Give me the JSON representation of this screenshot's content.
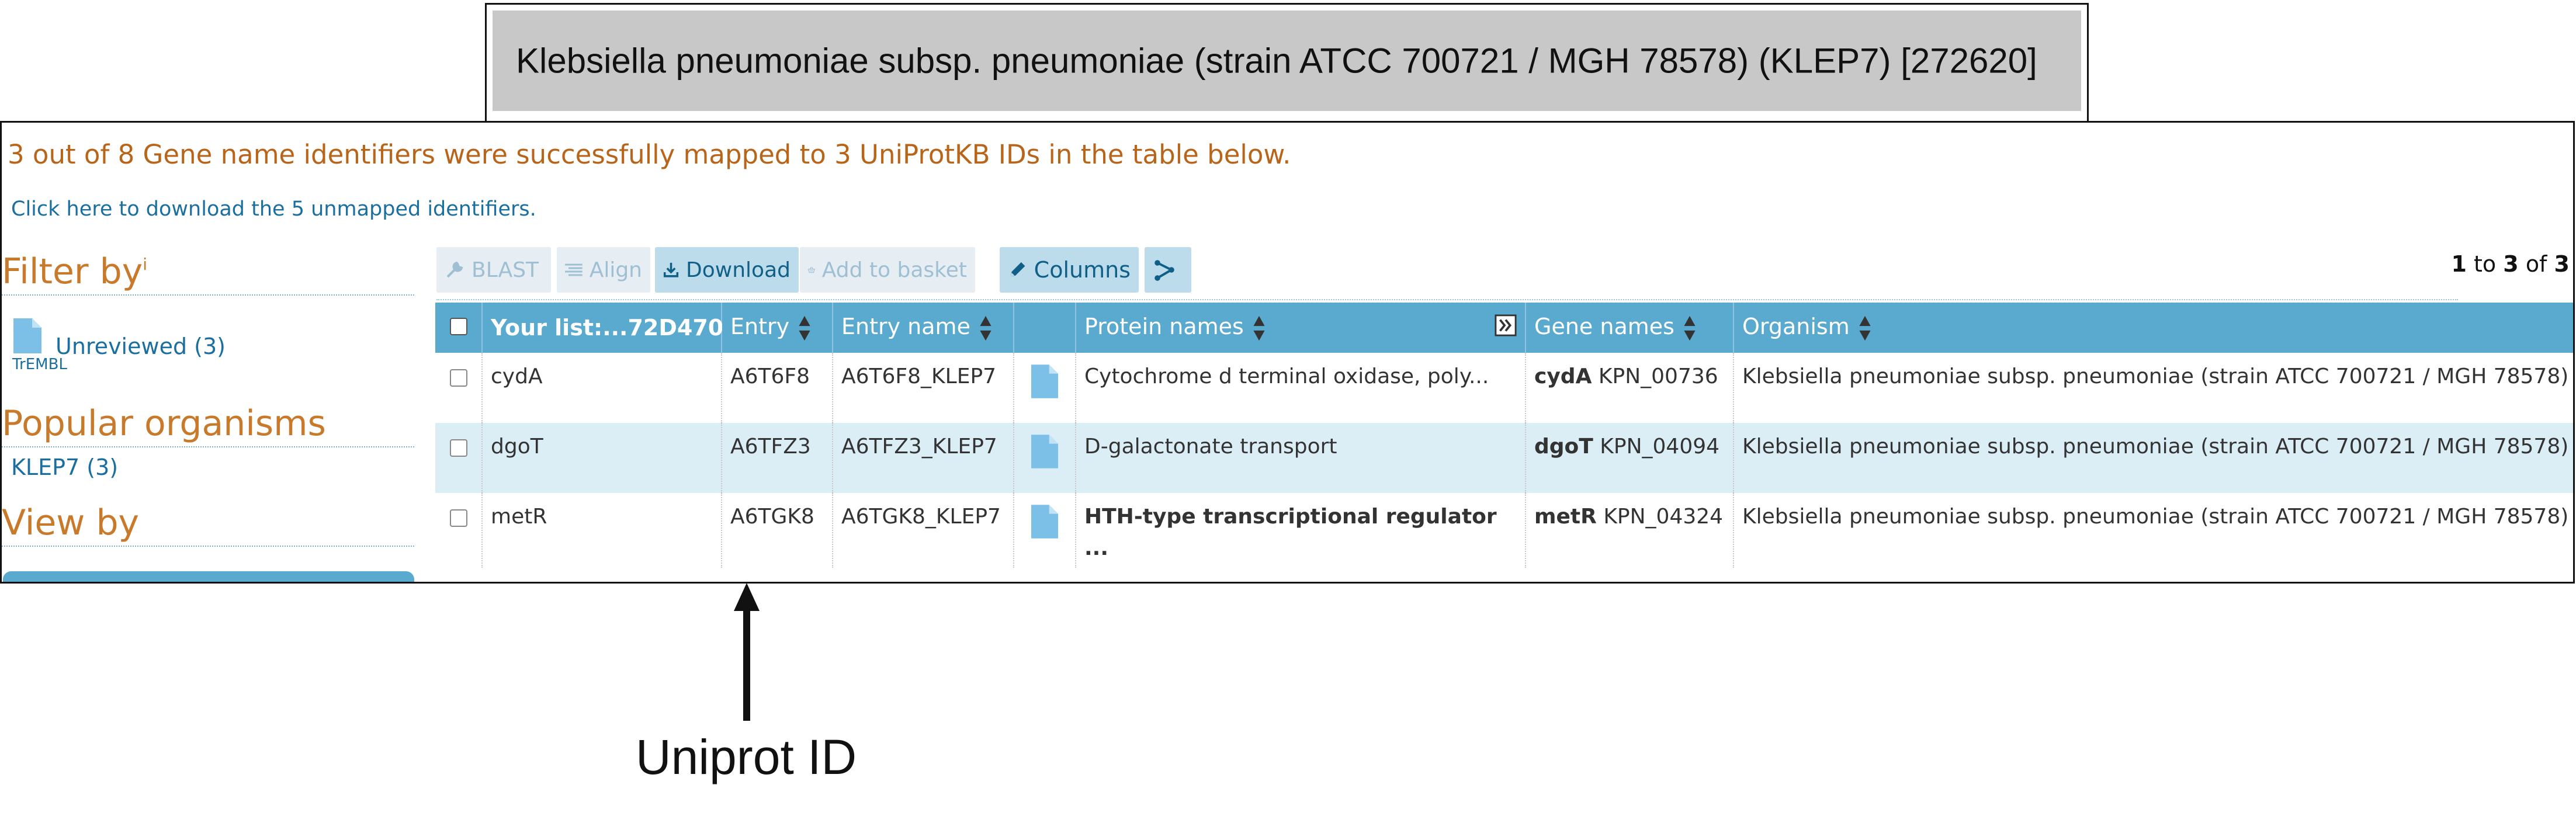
{
  "organism_title": "Klebsiella pneumoniae subsp. pneumoniae (strain ATCC 700721 / MGH 78578) (KLEP7) [272620]",
  "summary": "3 out of 8 Gene name identifiers were successfully mapped to 3 UniProtKB IDs in the table below.",
  "download_unmapped": "Click here to download the 5 unmapped identifiers.",
  "sidebar": {
    "filter_heading": "Filter by",
    "filter_superscript": "i",
    "unreviewed_label": "Unreviewed (3)",
    "trembl_label": "TrEMBL",
    "popular_heading": "Popular organisms",
    "klep7_label": "KLEP7 (3)",
    "viewby_heading": "View by"
  },
  "toolbar": {
    "blast": "BLAST",
    "align": "Align",
    "download": "Download",
    "add_to_basket": "Add to basket",
    "columns": "Columns",
    "pager_from": "1",
    "pager_to_word": "to",
    "pager_to": "3",
    "pager_of_word": "of",
    "pager_total": "3"
  },
  "table": {
    "headers": {
      "your_list": "Your list:...72D470",
      "entry": "Entry",
      "entry_name": "Entry name",
      "protein_names": "Protein names",
      "gene_names": "Gene names",
      "organism": "Organism"
    },
    "rows": [
      {
        "your_list": "cydA",
        "entry": "A6T6F8",
        "entry_name": "A6T6F8_KLEP7",
        "protein_names": "Cytochrome d terminal oxidase, poly...",
        "gene_primary": "cydA",
        "gene_orf": "KPN_00736",
        "organism": "Klebsiella pneumoniae subsp. pneumoniae (strain ATCC 700721 / MGH 78578)"
      },
      {
        "your_list": "dgoT",
        "entry": "A6TFZ3",
        "entry_name": "A6TFZ3_KLEP7",
        "protein_names": "D-galactonate transport",
        "gene_primary": "dgoT",
        "gene_orf": "KPN_04094",
        "organism": "Klebsiella pneumoniae subsp. pneumoniae (strain ATCC 700721 / MGH 78578)"
      },
      {
        "your_list": "metR",
        "entry": "A6TGK8",
        "entry_name": "A6TGK8_KLEP7",
        "protein_names": "HTH-type transcriptional regulator ...",
        "gene_primary": "metR",
        "gene_orf": "KPN_04324",
        "organism": "Klebsiella pneumoniae subsp. pneumoniae (strain ATCC 700721 / MGH 78578)"
      }
    ]
  },
  "annotation": {
    "label": "Uniprot ID"
  },
  "colors": {
    "header_blue": "#5aa9cf",
    "link_blue": "#1a6fa0",
    "heading_orange": "#c87a2a",
    "row_alt": "#dbeef6"
  }
}
